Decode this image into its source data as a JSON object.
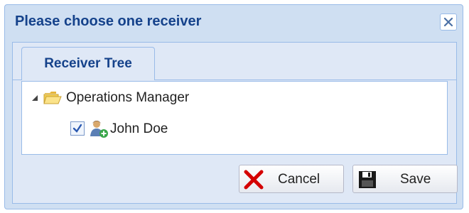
{
  "dialog": {
    "title": "Please choose one receiver",
    "tabs": [
      {
        "label": "Receiver Tree",
        "active": true
      }
    ],
    "tree": {
      "root": {
        "label": "Operations Manager",
        "expanded": true,
        "icon": "folder-icon",
        "children": [
          {
            "label": "John Doe",
            "checked": true,
            "icon": "person-add-icon"
          }
        ]
      }
    },
    "buttons": {
      "cancel_label": "Cancel",
      "save_label": "Save"
    }
  },
  "colors": {
    "title": "#15428b",
    "border": "#99bbe8",
    "frame": "#cfdff2",
    "panel": "#dfe8f6",
    "cancel_icon": "#d40000"
  }
}
